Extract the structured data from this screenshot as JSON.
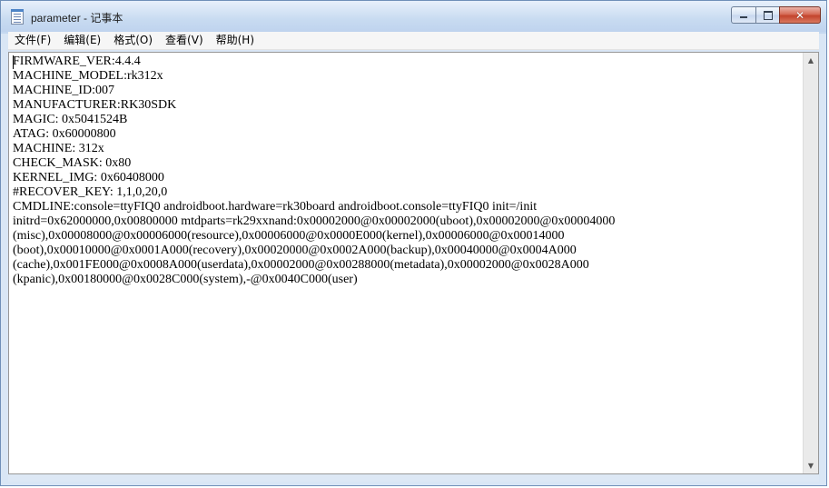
{
  "window": {
    "title": "parameter - 记事本",
    "app_icon": "notepad-icon",
    "controls": {
      "minimize_icon": "minimize-icon",
      "maximize_icon": "maximize-icon",
      "close_icon": "close-icon",
      "close_glyph": "✕"
    }
  },
  "menu": {
    "file": "文件(F)",
    "edit": "编辑(E)",
    "format": "格式(O)",
    "view": "查看(V)",
    "help": "帮助(H)"
  },
  "document": {
    "lines": [
      "FIRMWARE_VER:4.4.4",
      "MACHINE_MODEL:rk312x",
      "MACHINE_ID:007",
      "MANUFACTURER:RK30SDK",
      "MAGIC: 0x5041524B",
      "ATAG: 0x60000800",
      "MACHINE: 312x",
      "CHECK_MASK: 0x80",
      "KERNEL_IMG: 0x60408000",
      "#RECOVER_KEY: 1,1,0,20,0",
      "CMDLINE:console=ttyFIQ0 androidboot.hardware=rk30board androidboot.console=ttyFIQ0 init=/init",
      "initrd=0x62000000,0x00800000 mtdparts=rk29xxnand:0x00002000@0x00002000(uboot),0x00002000@0x00004000",
      "(misc),0x00008000@0x00006000(resource),0x00006000@0x0000E000(kernel),0x00006000@0x00014000",
      "(boot),0x00010000@0x0001A000(recovery),0x00020000@0x0002A000(backup),0x00040000@0x0004A000",
      "(cache),0x001FE000@0x0008A000(userdata),0x00002000@0x00288000(metadata),0x00002000@0x0028A000",
      "(kpanic),0x00180000@0x0028C000(system),-@0x0040C000(user)"
    ]
  },
  "scrollbar": {
    "up_arrow": "▲",
    "down_arrow": "▼"
  }
}
